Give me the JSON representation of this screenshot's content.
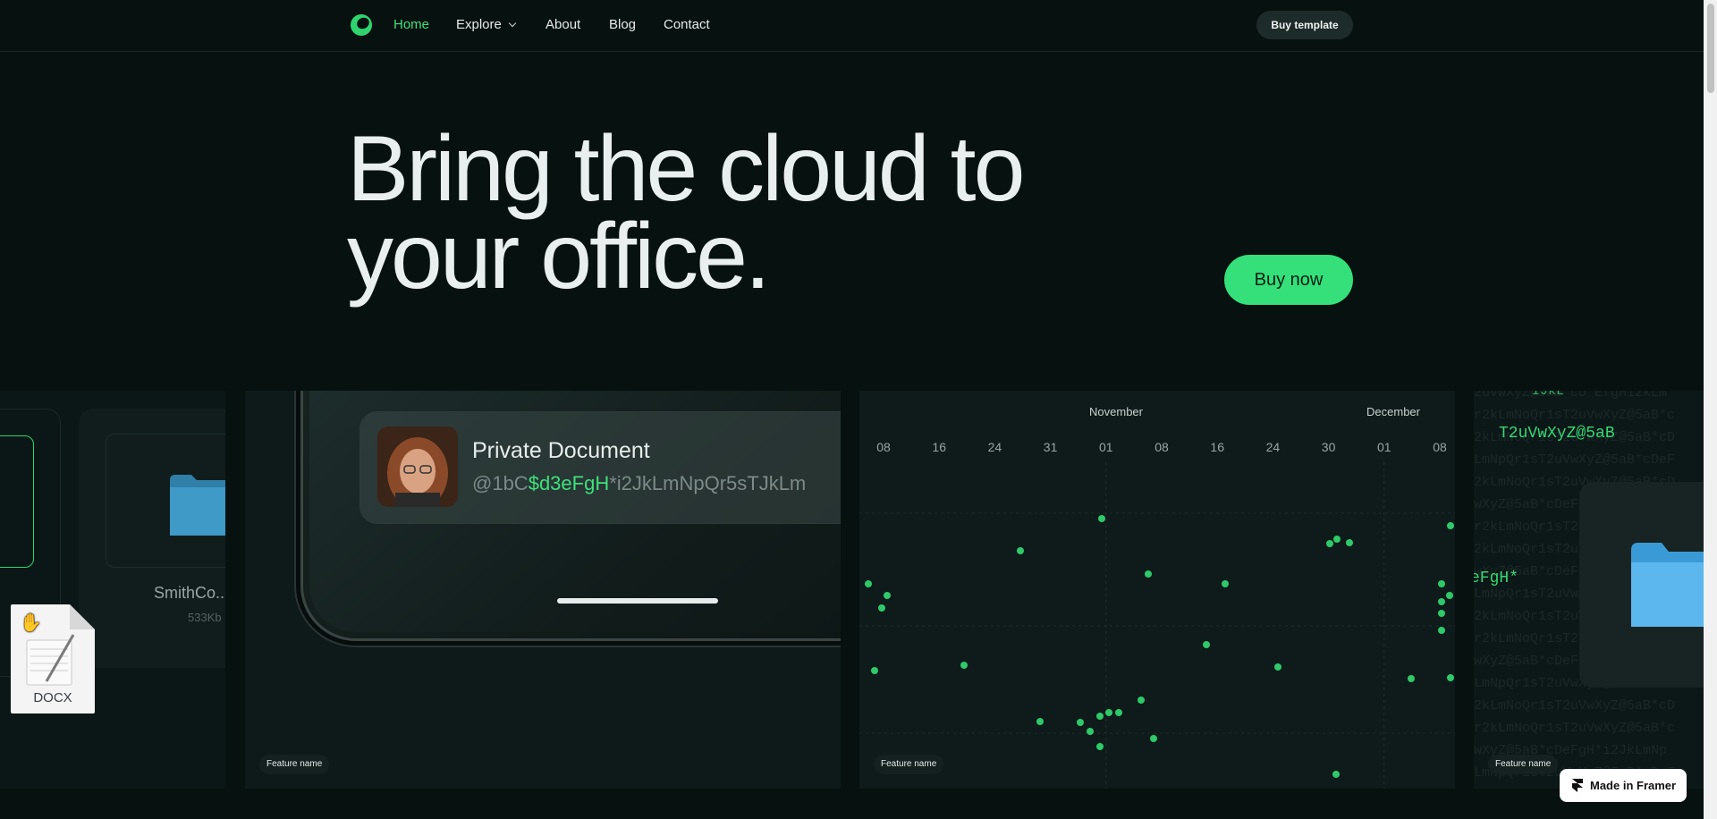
{
  "nav": {
    "links": [
      "Home",
      "Explore",
      "About",
      "Blog",
      "Contact"
    ],
    "cta_label": "Buy template"
  },
  "hero": {
    "title": "Bring the cloud to\nyour office.",
    "cta_label": "Buy now"
  },
  "cards": [
    {
      "file_name": "SmithCo..",
      "file_size": "533Kb"
    },
    {
      "notification_title": "Private Document",
      "code_pre": "@1bC",
      "code_highlight": "$d3eFgH",
      "code_post": "*i2JkLmNpQr5sTJkLm",
      "tag": "Feature name"
    },
    {
      "months": [
        "November",
        "December"
      ],
      "ticks": [
        "08",
        "16",
        "24",
        "31",
        "01",
        "08",
        "16",
        "24",
        "30",
        "01",
        "08"
      ],
      "tag": "Feature name"
    },
    {
      "code_hl0": "IJkL",
      "code_hl1": "T2uVwXyZ@5aB",
      "code_hl2": "eFgH*",
      "tag": "Feature name"
    }
  ],
  "docx_label": "DOCX",
  "framer_label": "Made in Framer",
  "colors": {
    "accent": "#35e07a",
    "background": "#061110"
  }
}
